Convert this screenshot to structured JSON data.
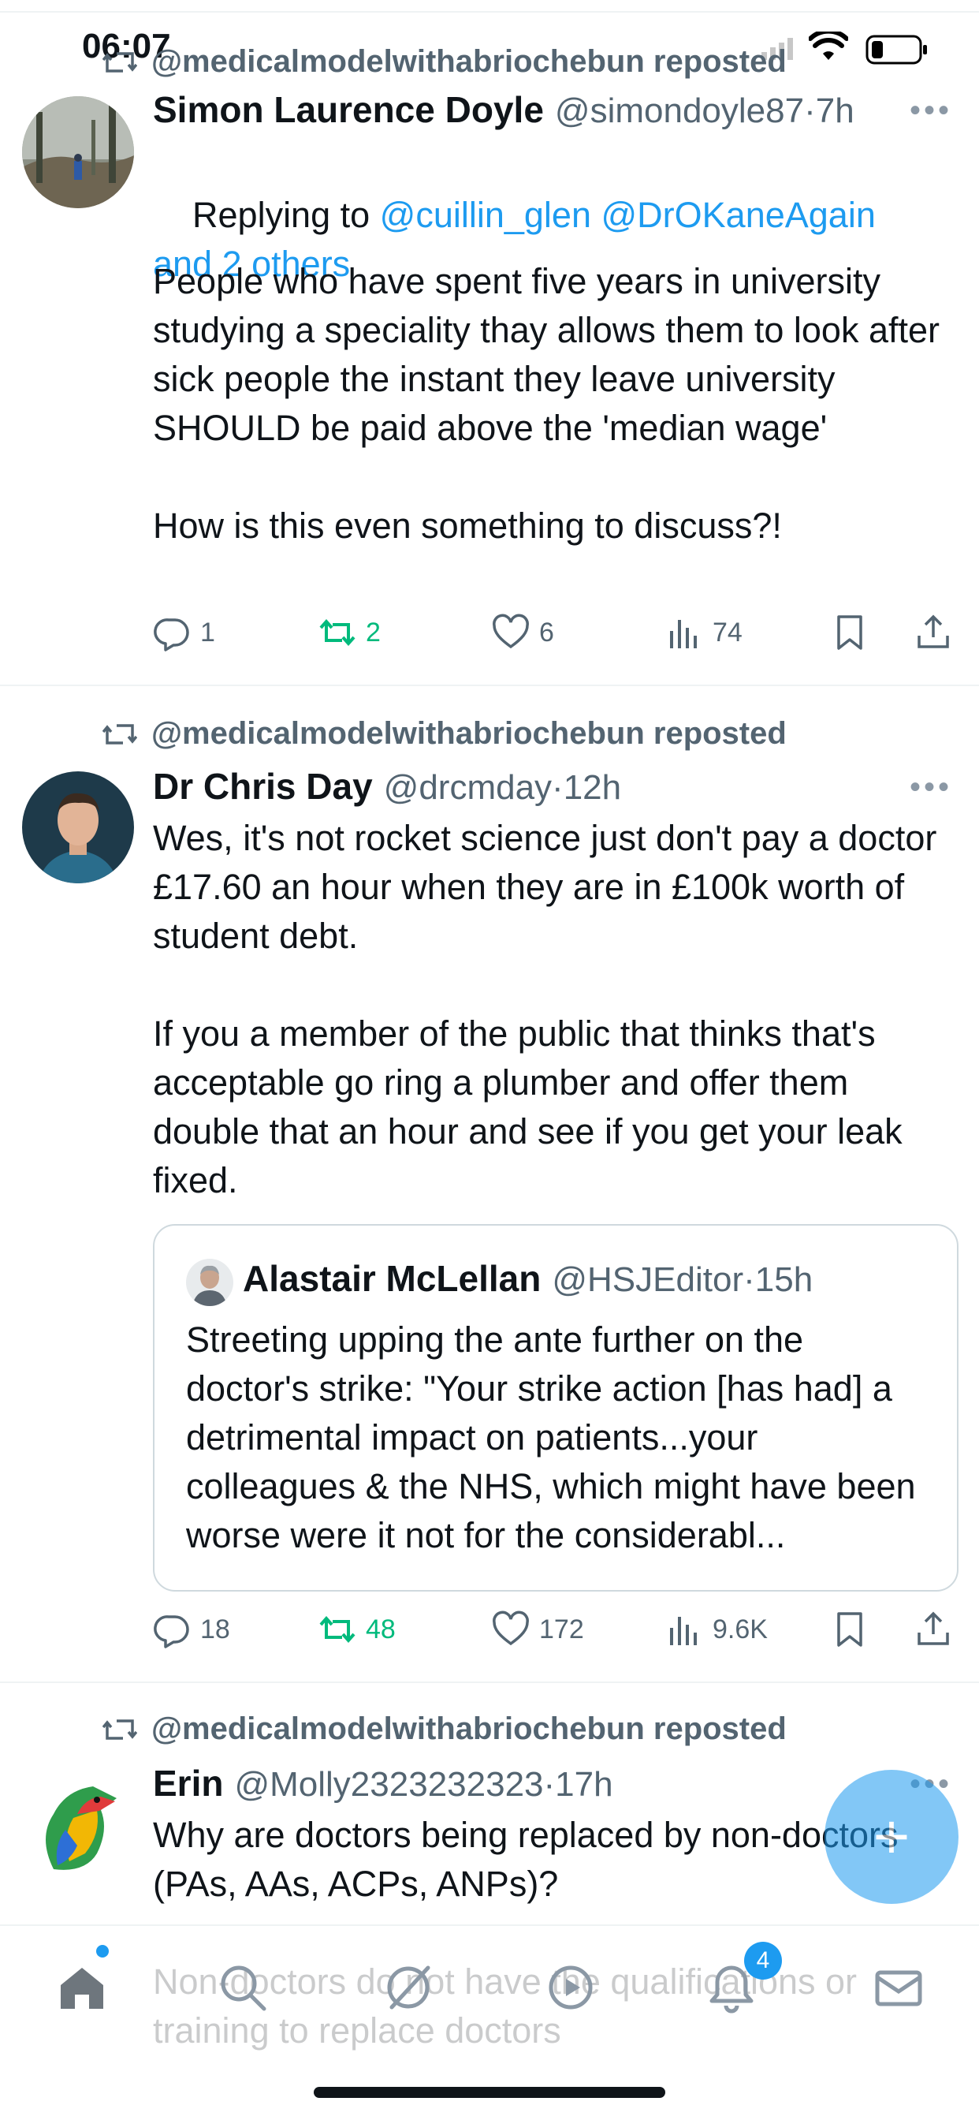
{
  "status_bar": {
    "time": "06:07"
  },
  "tweets": [
    {
      "reposted_by": "@medicalmodelwithabriochebun reposted",
      "name": "Simon Laurence Doyle",
      "handle": "@simondoyle87",
      "sep": "·",
      "time": "7h",
      "reply_prefix": "Replying to ",
      "reply_to": "@cuillin_glen @DrOKaneAgain and 2 others",
      "text": "People who have spent five years in university studying a speciality thay allows them to look after sick people the instant they leave university SHOULD be paid above the 'median wage'\n\nHow is this even something to discuss?!",
      "replies": "1",
      "reposts": "2",
      "likes": "6",
      "views": "74"
    },
    {
      "reposted_by": "@medicalmodelwithabriochebun reposted",
      "name": "Dr Chris Day",
      "handle": "@drcmday",
      "sep": "·",
      "time": "12h",
      "text": "Wes, it's not rocket science just don't pay a doctor £17.60 an hour when they are in £100k worth of student debt.\n\nIf you a member of the public that thinks that's acceptable go ring a plumber and offer them double that an hour and see if you get your leak fixed.",
      "quote": {
        "name": "Alastair McLellan",
        "handle": "@HSJEditor",
        "sep": "·",
        "time": "15h",
        "text": "Streeting upping the ante further on the doctor's strike: \"Your strike action [has had] a detrimental impact on patients...your colleagues & the NHS, which might have been worse were it not for the considerabl..."
      },
      "replies": "18",
      "reposts": "48",
      "likes": "172",
      "views": "9.6K"
    },
    {
      "reposted_by": "@medicalmodelwithabriochebun reposted",
      "name": "Erin",
      "handle": "@Molly2323232323",
      "sep": "·",
      "time": "17h",
      "text": "Why are doctors being replaced by non-doctors (PAs, AAs, ACPs, ANPs)?\n\nNon-doctors do not have the qualifications or training to replace doctors\n\nIt is not safe for non-doctors to replace doct"
    }
  ],
  "tab_bar": {
    "notifications_badge": "4"
  },
  "colors": {
    "accent": "#1d9bf0",
    "repost_green": "#00ba7c",
    "muted": "#536471"
  }
}
